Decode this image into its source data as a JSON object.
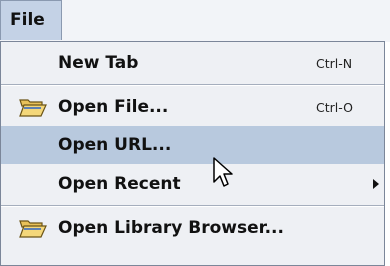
{
  "menubar": {
    "file_label": "File"
  },
  "menu": {
    "items": [
      {
        "label": "New Tab",
        "shortcut": "Ctrl-N",
        "icon": ""
      },
      {
        "label": "Open File...",
        "shortcut": "Ctrl-O",
        "icon": "open-folder-icon"
      },
      {
        "label": "Open URL...",
        "shortcut": "",
        "icon": "",
        "highlighted": true
      },
      {
        "label": "Open Recent",
        "shortcut": "",
        "icon": "",
        "submenu": true
      },
      {
        "label": "Open Library Browser...",
        "shortcut": "",
        "icon": "open-folder-icon"
      }
    ]
  },
  "colors": {
    "highlight": "#b8c9de",
    "menu_bg": "#eef0f4",
    "file_bg": "#c4d2e6"
  }
}
